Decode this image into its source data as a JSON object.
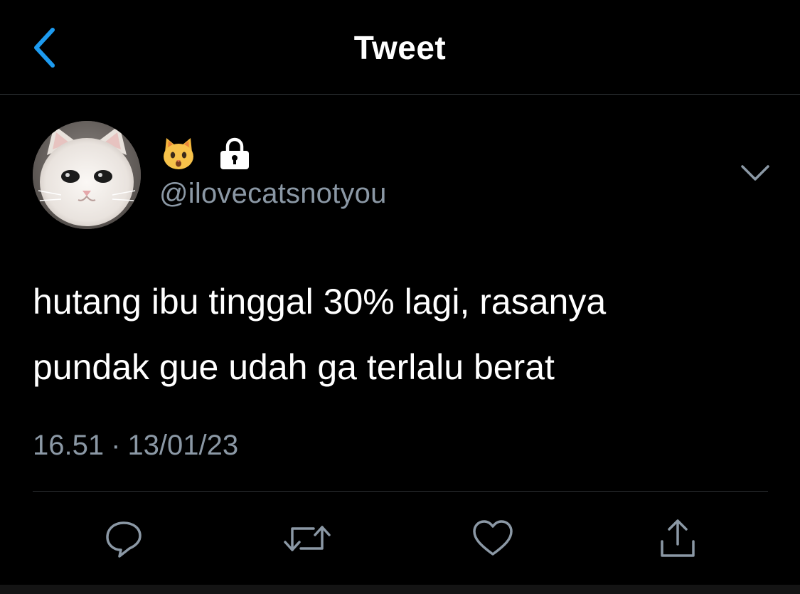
{
  "header": {
    "title": "Tweet",
    "back_icon": "chevron-left-icon",
    "accent_color": "#1d9bf0"
  },
  "tweet": {
    "author": {
      "name_icons": [
        "cat-face-emoji-icon",
        "lock-icon"
      ],
      "handle": "@ilovecatsnotyou",
      "avatar": "white-cat-photo"
    },
    "text_lines": [
      "hutang ibu tinggal 30% lagi, rasanya",
      "pundak gue udah ga terlalu berat"
    ],
    "time": "16.51",
    "separator": "·",
    "date": "13/01/23",
    "more_icon": "chevron-down-icon"
  },
  "actions": [
    "reply-icon",
    "retweet-icon",
    "like-icon",
    "share-icon"
  ],
  "colors": {
    "background": "#000000",
    "text": "#ffffff",
    "secondary_text": "#8b98a5",
    "divider": "#2f3336"
  }
}
